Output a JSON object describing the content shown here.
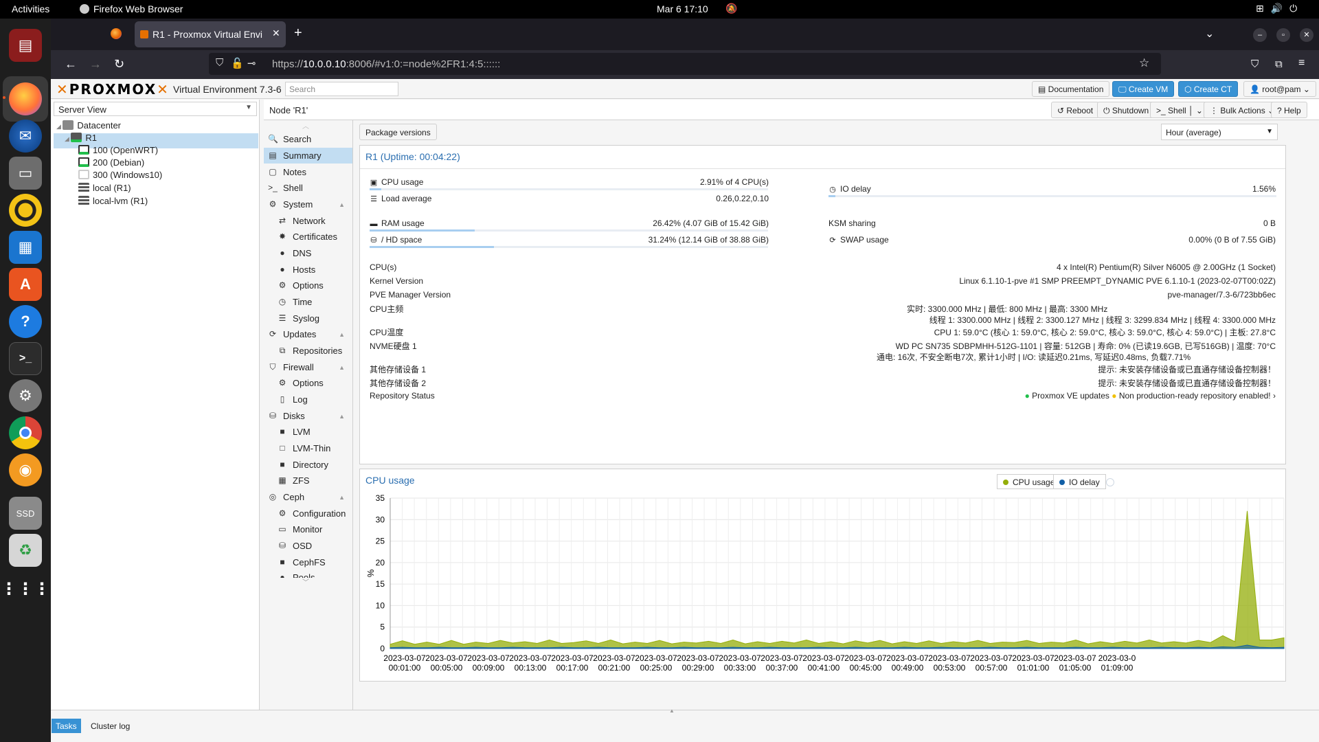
{
  "topbar": {
    "activities": "Activities",
    "app_name": "Firefox Web Browser",
    "clock": "Mar 6  17:10"
  },
  "dock": {
    "icons": [
      "file-manager-icon",
      "firefox-icon",
      "thunderbird-icon",
      "files-icon",
      "rhythmbox-icon",
      "writer-icon",
      "app-center-icon",
      "help-icon",
      "terminal-icon",
      "settings-icon",
      "chrome-icon",
      "gimp-icon",
      "ssd-icon",
      "trash-icon",
      "show-apps-icon"
    ],
    "ssd_label": "SSD"
  },
  "browser": {
    "tab_title": "R1 - Proxmox Virtual Envi",
    "url_prefix": "https://",
    "url_host": "10.0.0.10",
    "url_rest": ":8006/#v1:0:=node%2FR1:4:5::::::"
  },
  "pve": {
    "logo": "PROXMOX",
    "version": "Virtual Environment 7.3-6",
    "search_placeholder": "Search",
    "header_buttons": {
      "docs": "Documentation",
      "create_vm": "Create VM",
      "create_ct": "Create CT",
      "user": "root@pam"
    },
    "view": "Server View",
    "tree": {
      "datacenter": "Datacenter",
      "node": "R1",
      "vm1": "100 (OpenWRT)",
      "vm2": "200 (Debian)",
      "vm3": "300 (Windows10)",
      "storage1": "local (R1)",
      "storage2": "local-lvm (R1)"
    },
    "node_title": "Node 'R1'",
    "toolbar": {
      "reboot": "Reboot",
      "shutdown": "Shutdown",
      "shell": "Shell",
      "bulk": "Bulk Actions",
      "help": "Help"
    },
    "menu": {
      "search": "Search",
      "summary": "Summary",
      "notes": "Notes",
      "shell": "Shell",
      "system": "System",
      "network": "Network",
      "certificates": "Certificates",
      "dns": "DNS",
      "hosts": "Hosts",
      "options": "Options",
      "time": "Time",
      "syslog": "Syslog",
      "updates": "Updates",
      "repositories": "Repositories",
      "firewall": "Firewall",
      "fw_options": "Options",
      "log": "Log",
      "disks": "Disks",
      "lvm": "LVM",
      "lvm_thin": "LVM-Thin",
      "directory": "Directory",
      "zfs": "ZFS",
      "ceph": "Ceph",
      "configuration": "Configuration",
      "monitor": "Monitor",
      "osd": "OSD",
      "cephfs": "CephFS",
      "pools": "Pools"
    },
    "package_versions": "Package versions",
    "timeframe": "Hour (average)",
    "status": {
      "title": "R1 (Uptime: 00:04:22)",
      "cpu_label": "CPU usage",
      "cpu_value": "2.91% of 4 CPU(s)",
      "cpu_pct": 0.0291,
      "io_label": "IO delay",
      "io_value": "1.56%",
      "io_pct": 0.0156,
      "load_label": "Load average",
      "load_value": "0.26,0.22,0.10",
      "ram_label": "RAM usage",
      "ram_value": "26.42% (4.07 GiB of 15.42 GiB)",
      "ram_pct": 0.2642,
      "ksm_label": "KSM sharing",
      "ksm_value": "0 B",
      "hd_label": "/ HD space",
      "hd_value": "31.24% (12.14 GiB of 38.88 GiB)",
      "hd_pct": 0.3124,
      "swap_label": "SWAP usage",
      "swap_value": "0.00% (0 B of 7.55 GiB)",
      "cpus_label": "CPU(s)",
      "cpus_value": "4 x Intel(R) Pentium(R) Silver N6005 @ 2.00GHz (1 Socket)",
      "kernel_label": "Kernel Version",
      "kernel_value": "Linux 6.1.10-1-pve #1 SMP PREEMPT_DYNAMIC PVE 6.1.10-1 (2023-02-07T00:02Z)",
      "pve_label": "PVE Manager Version",
      "pve_value": "pve-manager/7.3-6/723bb6ec",
      "freq_label": "CPU主频",
      "freq_value1": "实时: 3300.000 MHz | 最低: 800 MHz | 最高: 3300 MHz",
      "freq_value2": "线程 1: 3300.000 MHz | 线程 2: 3300.127 MHz | 线程 3: 3299.834 MHz | 线程 4: 3300.000 MHz",
      "temp_label": "CPU温度",
      "temp_value": "CPU 1: 59.0°C (核心 1: 59.0°C, 核心 2: 59.0°C, 核心 3: 59.0°C, 核心 4: 59.0°C) | 主板: 27.8°C",
      "nvme_label": "NVME硬盘 1",
      "nvme_value1": "WD PC SN735 SDBPMHH-512G-1101 | 容量: 512GB | 寿命: 0% (已读19.6GB, 已写516GB) | 温度: 70°C",
      "nvme_value2": "通电: 16次, 不安全断电7次, 累计1小时 | I/O: 读延迟0.21ms, 写延迟0.48ms, 负载7.71%",
      "other1_label": "其他存储设备 1",
      "other1_value": "提示: 未安装存储设备或已直通存储设备控制器！",
      "other2_label": "其他存储设备 2",
      "other2_value": "提示: 未安装存储设备或已直通存储设备控制器！",
      "repo_label": "Repository Status",
      "repo_ok": "Proxmox VE updates",
      "repo_warn": "Non production-ready repository enabled!"
    },
    "bottom": {
      "tasks": "Tasks",
      "cluster_log": "Cluster log"
    }
  },
  "chart_data": {
    "type": "area",
    "title": "CPU usage",
    "ylabel": "%",
    "ylim": [
      0,
      35
    ],
    "yticks": [
      0,
      5,
      10,
      15,
      20,
      25,
      30,
      35
    ],
    "grid": true,
    "legend": [
      {
        "name": "CPU usage",
        "color": "#94ae0a"
      },
      {
        "name": "IO delay",
        "color": "#115fa6"
      }
    ],
    "xtick_labels": [
      [
        "2023-03-07",
        "00:01:00"
      ],
      [
        "2023-03-07",
        "00:05:00"
      ],
      [
        "2023-03-07",
        "00:09:00"
      ],
      [
        "2023-03-07",
        "00:13:00"
      ],
      [
        "2023-03-07",
        "00:17:00"
      ],
      [
        "2023-03-07",
        "00:21:00"
      ],
      [
        "2023-03-07",
        "00:25:00"
      ],
      [
        "2023-03-07",
        "00:29:00"
      ],
      [
        "2023-03-07",
        "00:33:00"
      ],
      [
        "2023-03-07",
        "00:37:00"
      ],
      [
        "2023-03-07",
        "00:41:00"
      ],
      [
        "2023-03-07",
        "00:45:00"
      ],
      [
        "2023-03-07",
        "00:49:00"
      ],
      [
        "2023-03-07",
        "00:53:00"
      ],
      [
        "2023-03-07",
        "00:57:00"
      ],
      [
        "2023-03-07",
        "01:01:00"
      ],
      [
        "2023-03-07",
        "01:05:00"
      ],
      [
        "2023-03-0",
        "01:09:00"
      ]
    ],
    "series": [
      {
        "name": "CPU usage",
        "values": [
          1.0,
          1.8,
          1.0,
          1.5,
          1.0,
          1.9,
          1.0,
          1.5,
          1.2,
          1.9,
          1.3,
          1.6,
          1.2,
          2.0,
          1.2,
          1.4,
          1.8,
          1.2,
          2.0,
          1.1,
          1.5,
          1.2,
          1.9,
          1.1,
          1.5,
          1.3,
          1.7,
          1.2,
          2.0,
          1.1,
          1.6,
          1.2,
          1.7,
          1.3,
          2.0,
          1.2,
          1.6,
          1.1,
          1.8,
          1.3,
          1.9,
          1.1,
          1.6,
          1.2,
          1.8,
          1.2,
          1.6,
          1.3,
          1.9,
          1.2,
          1.5,
          1.4,
          1.9,
          1.2,
          1.5,
          1.3,
          2.0,
          1.1,
          1.6,
          1.2,
          1.7,
          1.3,
          2.0,
          1.3,
          1.6,
          1.3,
          1.9,
          1.4,
          3.0,
          1.6,
          32.0,
          2.0,
          2.0,
          2.5
        ]
      },
      {
        "name": "IO delay",
        "values": [
          0.2,
          0.3,
          0.2,
          0.2,
          0.3,
          0.2,
          0.2,
          0.3,
          0.2,
          0.2,
          0.3,
          0.2,
          0.2,
          0.2,
          0.3,
          0.2,
          0.2,
          0.3,
          0.2,
          0.2,
          0.2,
          0.3,
          0.2,
          0.2,
          0.3,
          0.2,
          0.2,
          0.2,
          0.3,
          0.2,
          0.2,
          0.3,
          0.2,
          0.2,
          0.2,
          0.3,
          0.2,
          0.2,
          0.3,
          0.2,
          0.2,
          0.2,
          0.3,
          0.2,
          0.2,
          0.3,
          0.2,
          0.2,
          0.2,
          0.3,
          0.2,
          0.2,
          0.3,
          0.2,
          0.2,
          0.2,
          0.3,
          0.2,
          0.2,
          0.3,
          0.2,
          0.2,
          0.2,
          0.3,
          0.2,
          0.2,
          0.3,
          0.2,
          0.4,
          0.3,
          0.8,
          0.3,
          0.2,
          0.3
        ]
      }
    ]
  }
}
